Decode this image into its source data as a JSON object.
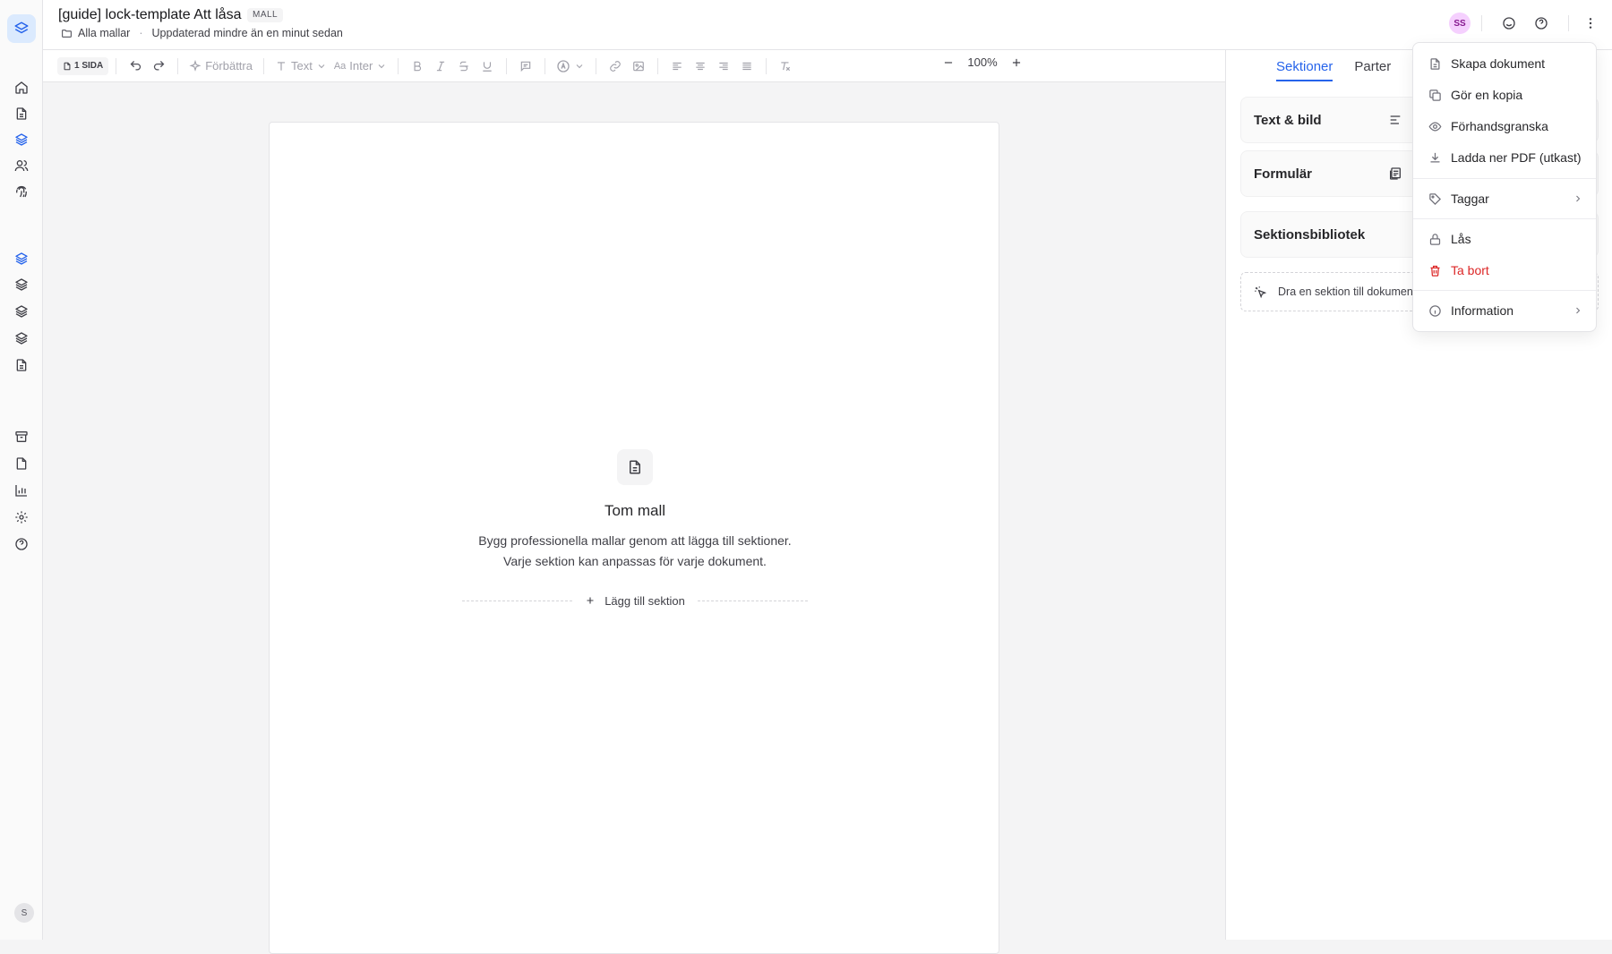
{
  "header": {
    "title": "[guide] lock-template Att låsa",
    "badge": "MALL",
    "breadcrumb_folder": "Alla mallar",
    "updated": "Uppdaterad mindre än en minut sedan",
    "avatar_initials": "SS"
  },
  "rail": {
    "user_initial": "S"
  },
  "toolbar": {
    "pages": "1 SIDA",
    "improve": "Förbättra",
    "text_style": "Text",
    "font": "Inter",
    "zoom": "100%"
  },
  "canvas": {
    "empty_title": "Tom mall",
    "empty_line1": "Bygg professionella mallar genom att lägga till sektioner.",
    "empty_line2": "Varje sektion kan anpassas för varje dokument.",
    "add_section": "Lägg till sektion"
  },
  "panel": {
    "tabs": [
      "Sektioner",
      "Parter"
    ],
    "cards": [
      "Text & bild",
      "Formulär",
      "Sektionsbibliotek"
    ],
    "drop_hint": "Dra en sektion till dokumen"
  },
  "menu": {
    "items": [
      {
        "label": "Skapa dokument",
        "icon": "file-icon"
      },
      {
        "label": "Gör en kopia",
        "icon": "copy-icon"
      },
      {
        "label": "Förhandsgranska",
        "icon": "eye-icon"
      },
      {
        "label": "Ladda ner PDF (utkast)",
        "icon": "download-icon"
      },
      {
        "label": "Taggar",
        "icon": "tag-icon"
      },
      {
        "label": "Lås",
        "icon": "lock-icon"
      },
      {
        "label": "Ta bort",
        "icon": "trash-icon"
      },
      {
        "label": "Information",
        "icon": "info-icon"
      }
    ]
  },
  "colors": {
    "accent": "#2563eb",
    "danger": "#dc2626"
  }
}
